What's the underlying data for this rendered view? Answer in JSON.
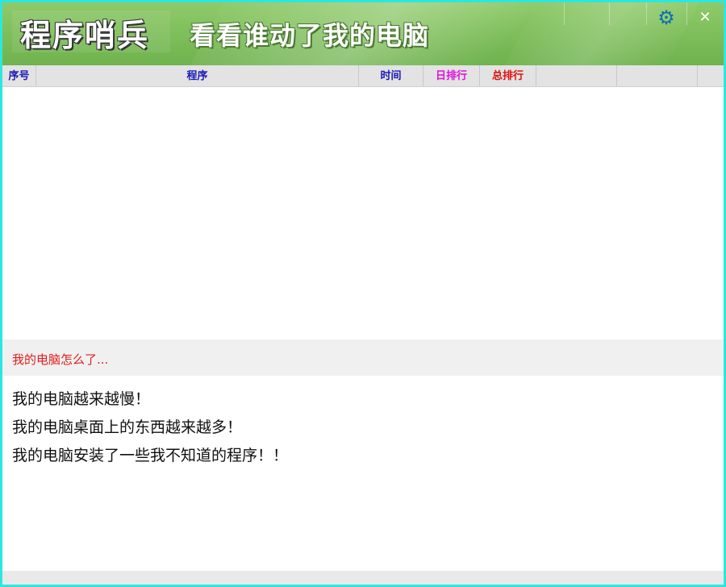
{
  "titlebar": {
    "app_title": "程序哨兵",
    "slogan": "看看谁动了我的电脑",
    "settings_icon": "gear-icon",
    "close_icon": "close-icon",
    "close_glyph": "✕",
    "gear_glyph": "⚙"
  },
  "table": {
    "columns": [
      {
        "label": "序号",
        "color": "#1a1ab8"
      },
      {
        "label": "程序",
        "color": "#1a1ab8"
      },
      {
        "label": "时间",
        "color": "#1a1ab8"
      },
      {
        "label": "日排行",
        "color": "#e010e0"
      },
      {
        "label": "总排行",
        "color": "#e01010"
      },
      {
        "label": "",
        "color": "#1a1ab8"
      },
      {
        "label": "",
        "color": "#1a1ab8"
      }
    ],
    "rows": []
  },
  "info": {
    "title": "我的电脑怎么了...",
    "lines": [
      "我的电脑越来越慢！",
      "我的电脑桌面上的东西越来越多！",
      "我的电脑安装了一些我不知道的程序！！"
    ]
  },
  "colors": {
    "border": "#2ee6e0",
    "titlebar": "#7dbd5a",
    "accent_red": "#e41c1c"
  }
}
